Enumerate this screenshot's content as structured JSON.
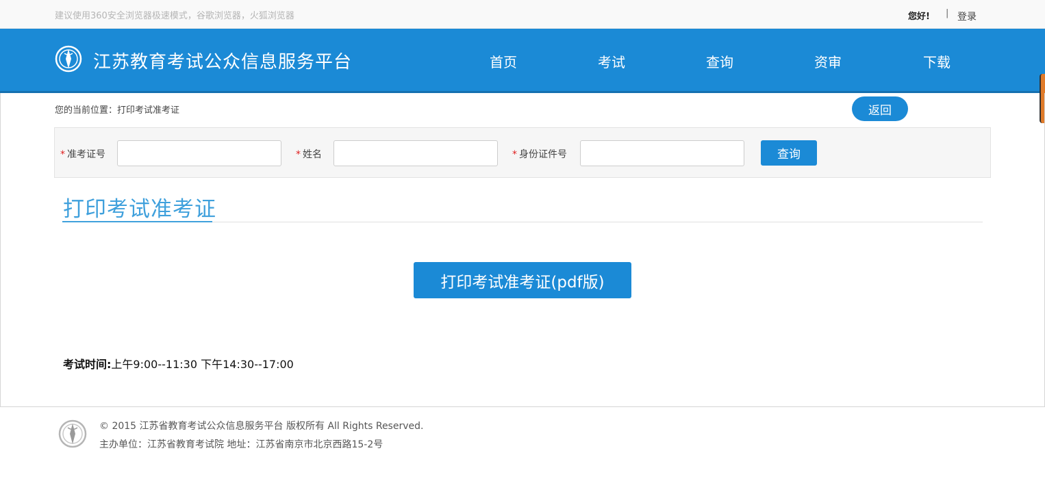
{
  "topbar": {
    "notice": "建议使用360安全浏览器极速模式，谷歌浏览器，火狐浏览器",
    "greeting": "您好!",
    "separator": "|",
    "login": "登录"
  },
  "header": {
    "site_title": "江苏教育考试公众信息服务平台",
    "nav": [
      "首页",
      "考试",
      "查询",
      "资审",
      "下载"
    ]
  },
  "breadcrumb": {
    "text": "您的当前位置：打印考试准考证",
    "back_label": "返回"
  },
  "search": {
    "fields": [
      {
        "label": "准考证号",
        "required_mark": "*",
        "value": ""
      },
      {
        "label": "姓名",
        "required_mark": "*",
        "value": ""
      },
      {
        "label": "身份证件号",
        "required_mark": "*",
        "value": ""
      }
    ],
    "query_label": "查询"
  },
  "section": {
    "title": "打印考试准考证",
    "print_label": "打印考试准考证(pdf版)"
  },
  "exam_time": {
    "label": "考试时间:",
    "value": "上午9:00--11:30 下午14:30--17:00"
  },
  "footer": {
    "line1": "© 2015 江苏省教育考试公众信息服务平台 版权所有 All Rights Reserved.",
    "line2": "主办单位：江苏省教育考试院 地址：江苏省南京市北京西路15-2号"
  },
  "colors": {
    "brand_blue": "#1b8ad6",
    "heading_blue": "#3fa0dc",
    "required_red": "#e02020"
  }
}
